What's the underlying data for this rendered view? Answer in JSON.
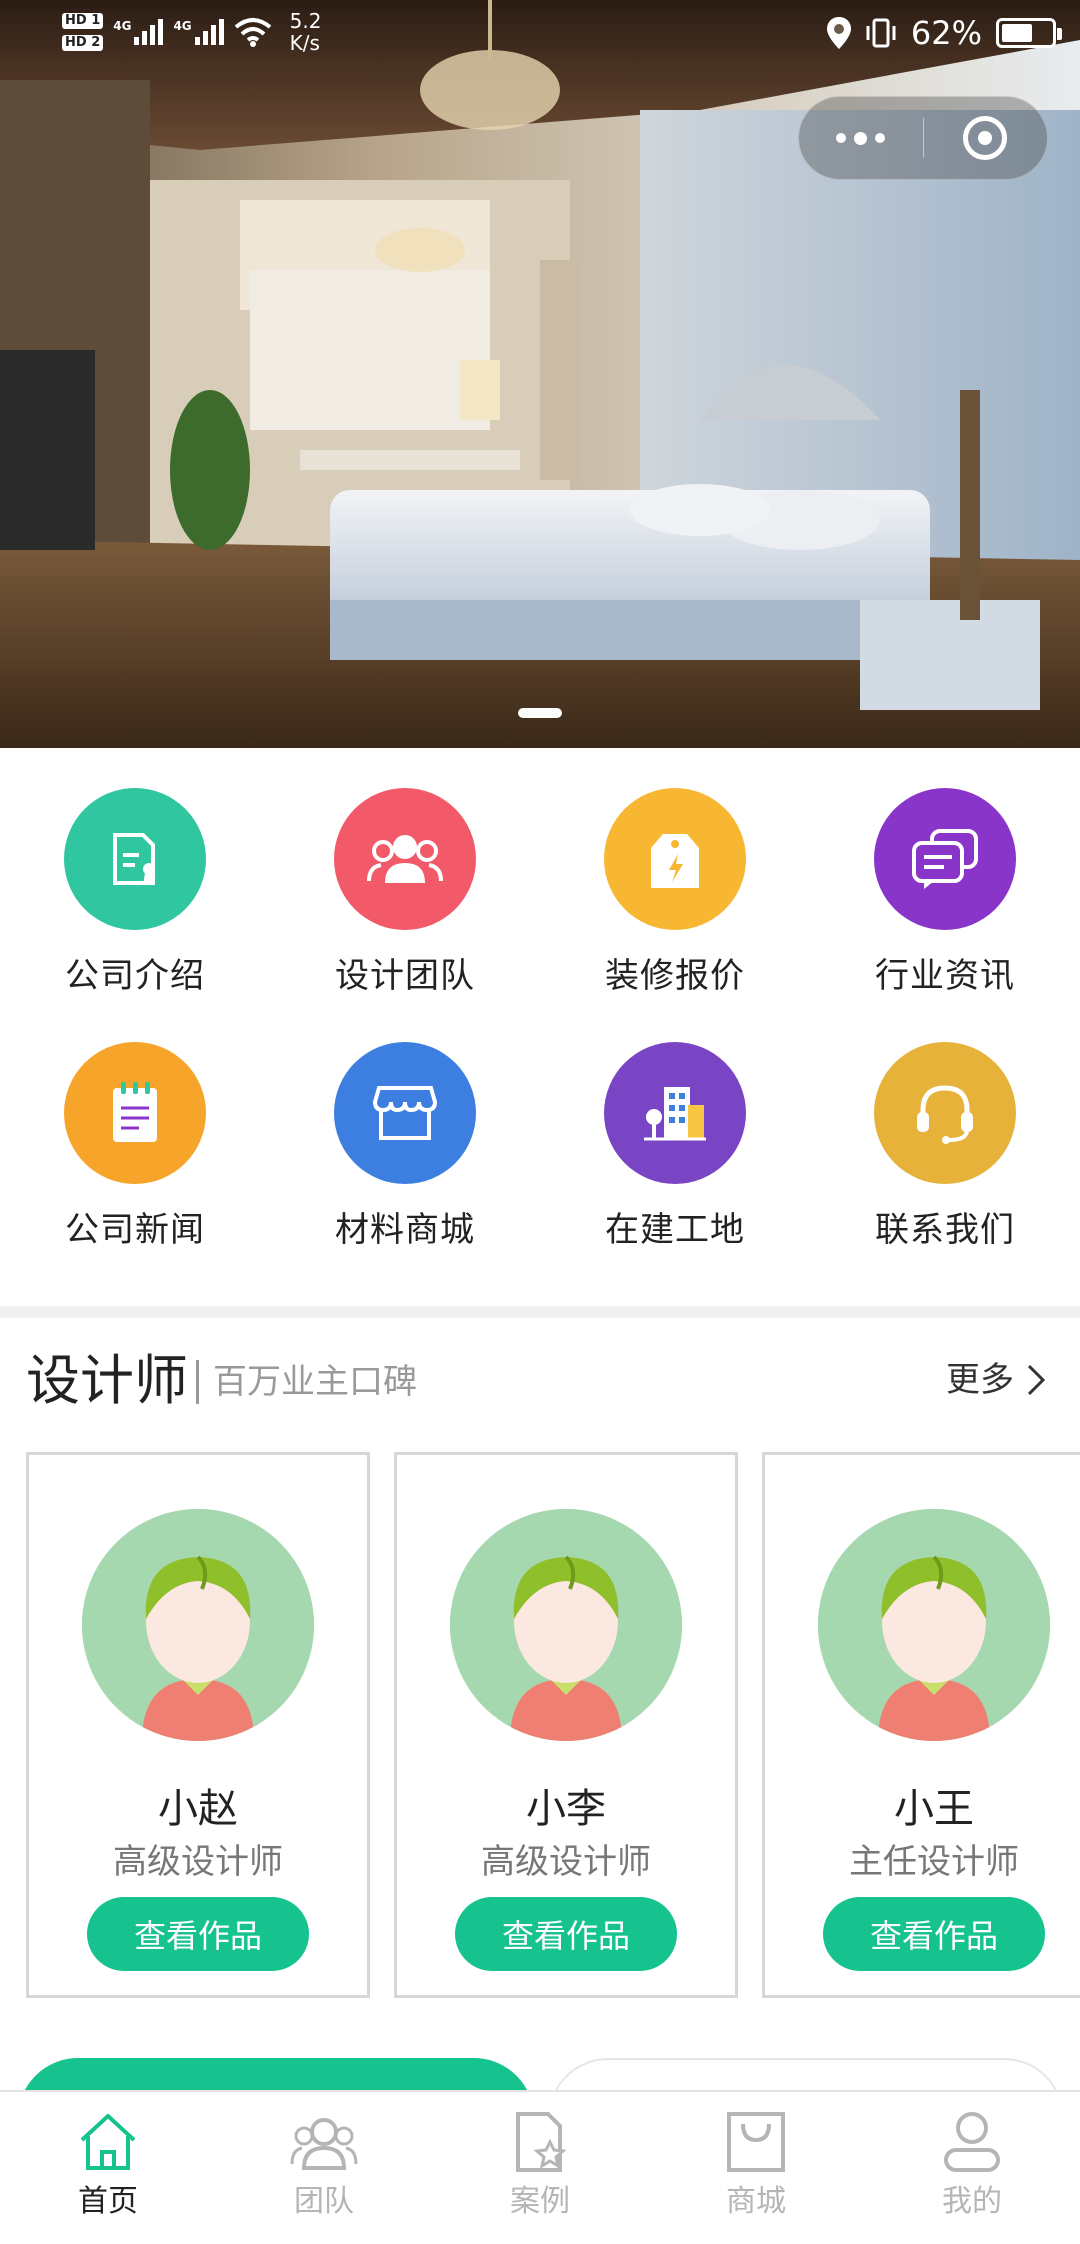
{
  "status_bar": {
    "sim1": "HD 1",
    "sim2": "HD 2",
    "network1": "4G",
    "network2": "4G",
    "speed_value": "5.2",
    "speed_unit": "K/s",
    "battery_percent": "62%",
    "battery_level": 0.62
  },
  "banner": {
    "image_icon": "bedroom-photo",
    "slide_count": 1
  },
  "menu": [
    {
      "label": "公司介绍",
      "icon": "document-certificate-icon",
      "color": "#2fc6a0"
    },
    {
      "label": "设计团队",
      "icon": "team-icon",
      "color": "#f25a6a"
    },
    {
      "label": "装修报价",
      "icon": "price-tag-icon",
      "color": "#f7b733"
    },
    {
      "label": "行业资讯",
      "icon": "chat-bubbles-icon",
      "color": "#8a35c9"
    },
    {
      "label": "公司新闻",
      "icon": "notepad-icon",
      "color": "#f7a52a"
    },
    {
      "label": "材料商城",
      "icon": "store-icon",
      "color": "#3d7fe0"
    },
    {
      "label": "在建工地",
      "icon": "building-icon",
      "color": "#7a45c4"
    },
    {
      "label": "联系我们",
      "icon": "headset-icon",
      "color": "#e6b23a"
    }
  ],
  "designers": {
    "title": "设计师",
    "subtitle": "百万业主口碑",
    "more_label": "更多",
    "items": [
      {
        "name": "小赵",
        "role": "高级设计师",
        "button": "查看作品"
      },
      {
        "name": "小李",
        "role": "高级设计师",
        "button": "查看作品"
      },
      {
        "name": "小王",
        "role": "主任设计师",
        "button": "查看作品"
      }
    ]
  },
  "tabbar": [
    {
      "label": "首页",
      "icon": "home-icon",
      "active": true
    },
    {
      "label": "团队",
      "icon": "team-icon",
      "active": false
    },
    {
      "label": "案例",
      "icon": "case-document-star-icon",
      "active": false
    },
    {
      "label": "商城",
      "icon": "shopping-bag-icon",
      "active": false
    },
    {
      "label": "我的",
      "icon": "user-icon",
      "active": false
    }
  ],
  "colors": {
    "accent": "#16c28e",
    "tab_inactive": "#b5b5b5",
    "card_border": "#d6d6d6"
  }
}
